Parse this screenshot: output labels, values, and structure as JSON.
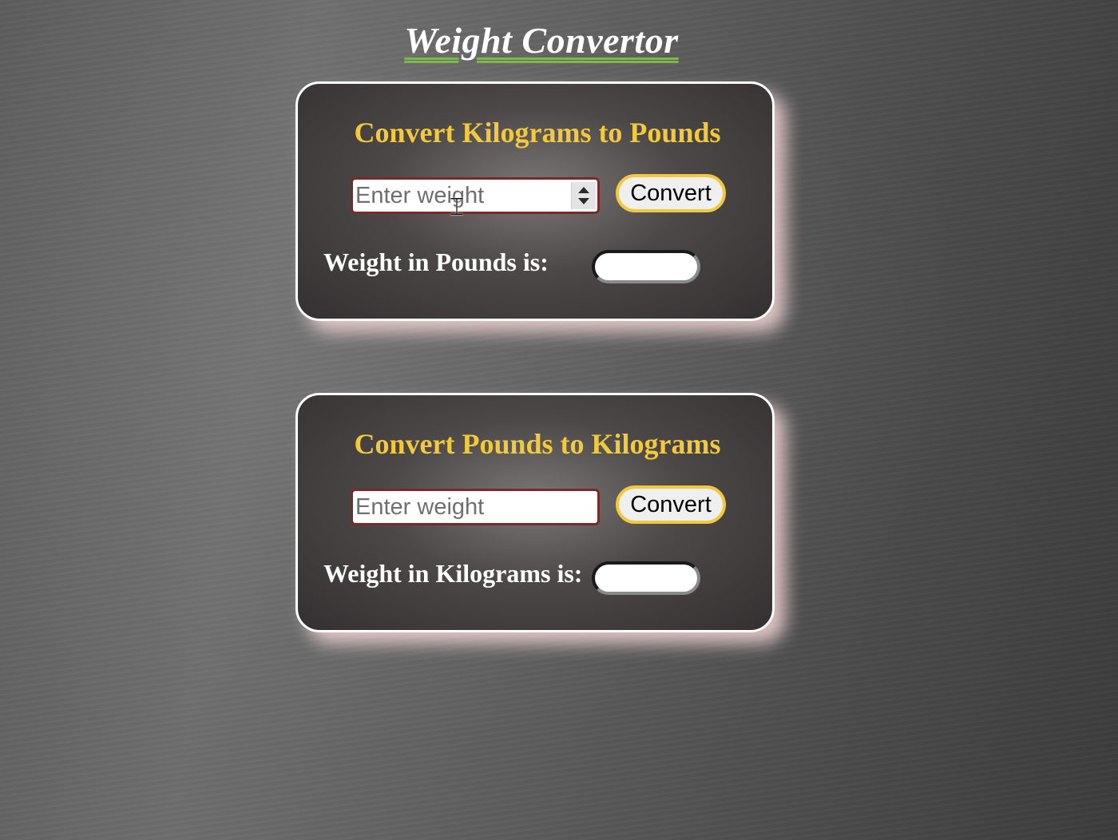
{
  "page": {
    "title": "Weight Convertor"
  },
  "kg_to_lb": {
    "heading": "Convert Kilograms to Pounds",
    "input_placeholder": "Enter weight",
    "input_value": "",
    "button_label": "Convert",
    "result_label": "Weight in Pounds is:",
    "result_value": ""
  },
  "lb_to_kg": {
    "heading": "Convert Pounds to Kilograms",
    "input_placeholder": "Enter weight",
    "input_value": "",
    "button_label": "Convert",
    "result_label": "Weight in Kilograms is:",
    "result_value": ""
  },
  "colors": {
    "heading": "#f2c93c",
    "title_underline": "#7cb84a",
    "input_border": "#7a2a2a",
    "button_border": "#f2c93c",
    "card_border": "#ffffff"
  },
  "icons": {
    "spinner": "spinner-arrows-icon",
    "cursor": "text-cursor-icon"
  }
}
